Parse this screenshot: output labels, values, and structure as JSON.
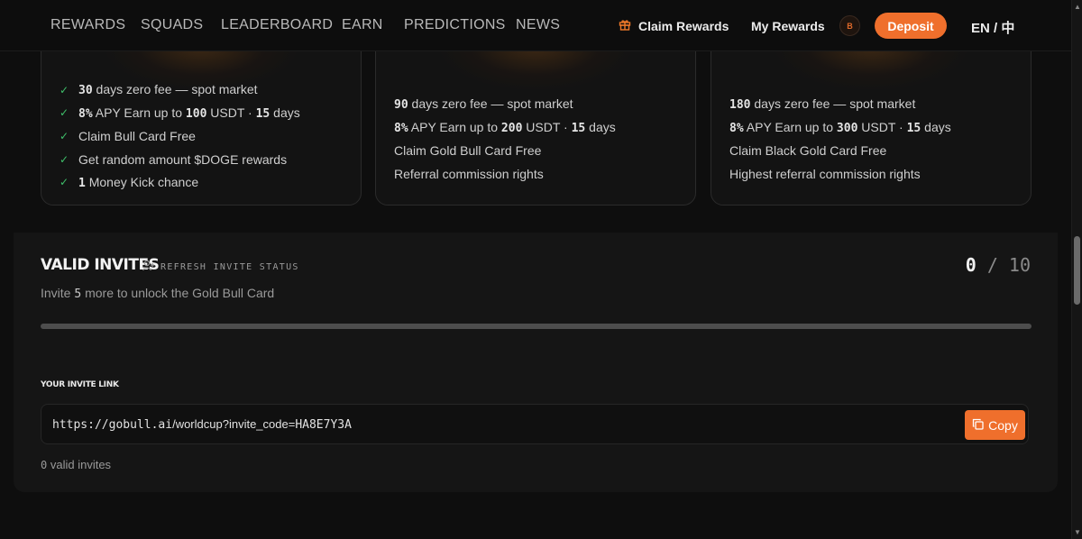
{
  "nav": {
    "items": [
      "REWARDS",
      "SQUADS",
      "LEADERBOARD",
      "EARN",
      "PREDICTIONS",
      "NEWS"
    ],
    "claim_label": "Claim Rewards",
    "my_rewards_label": "My Rewards",
    "avatar_initial": "B",
    "deposit_label": "Deposit",
    "lang_label": "EN / 中"
  },
  "tiers": [
    {
      "benefits": [
        {
          "num": "30",
          "text": " days zero fee — spot market",
          "checked": true
        },
        {
          "num": "8%",
          "text": " APY Earn up to ",
          "num2": "100",
          "text2": " USDT · ",
          "num3": "15",
          "text3": " days",
          "checked": true
        },
        {
          "text": "Claim Bull Card Free",
          "checked": true
        },
        {
          "text": "Get random amount $DOGE rewards",
          "checked": true
        },
        {
          "num": "1",
          "text": " Money Kick chance",
          "checked": true
        }
      ]
    },
    {
      "benefits": [
        {
          "num": "90",
          "text": " days zero fee — spot market"
        },
        {
          "num": "8%",
          "text": " APY Earn up to ",
          "num2": "200",
          "text2": " USDT · ",
          "num3": "15",
          "text3": " days"
        },
        {
          "text": "Claim Gold Bull Card Free"
        },
        {
          "text": "Referral commission rights"
        }
      ]
    },
    {
      "benefits": [
        {
          "num": "180",
          "text": " days zero fee — spot market"
        },
        {
          "num": "8%",
          "text": " APY Earn up to ",
          "num2": "300",
          "text2": " USDT · ",
          "num3": "15",
          "text3": " days"
        },
        {
          "text": "Claim Black Gold Card Free"
        },
        {
          "text": "Highest referral commission rights"
        }
      ]
    }
  ],
  "invites": {
    "title": "VALID INVITES",
    "refresh_label": "REFRESH INVITE STATUS",
    "current": "0",
    "separator": "/",
    "total": "10",
    "hint_prefix": "Invite ",
    "hint_num": "5",
    "hint_suffix": " more to unlock the Gold Bull Card",
    "progress_fraction": 0,
    "link_label": "YOUR INVITE LINK",
    "link_prefix": "https://",
    "link_domain": "gobull.ai",
    "link_path": "/worldcup?invite_code=",
    "link_code": "HA8E7Y3A",
    "copy_label": "Copy",
    "valid_num": "0",
    "valid_text": " valid invites"
  },
  "colors": {
    "accent": "#ef6f2c",
    "check": "#3fbf6a"
  }
}
